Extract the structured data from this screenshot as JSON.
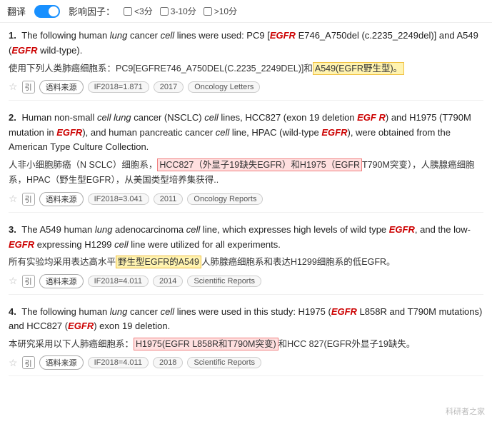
{
  "topbar": {
    "translate_label": "翻译",
    "influence_label": "影响因子：",
    "filters": [
      {
        "label": "<3分",
        "checked": false
      },
      {
        "label": "3-10分",
        "checked": false
      },
      {
        ">10分": ">10分",
        "label": ">10分",
        "checked": false
      }
    ]
  },
  "results": [
    {
      "number": "1.",
      "en_parts": [
        {
          "text": "The following human ",
          "style": "normal"
        },
        {
          "text": "lung",
          "style": "italic"
        },
        {
          "text": " cancer ",
          "style": "normal"
        },
        {
          "text": "cell",
          "style": "italic"
        },
        {
          "text": " lines were used: PC9 [",
          "style": "normal"
        },
        {
          "text": "EGFR",
          "style": "italic-red"
        },
        {
          "text": " E746_A750del (c.2235_2249del)] and A549 (",
          "style": "normal"
        },
        {
          "text": "EGFR",
          "style": "italic-red"
        },
        {
          "text": " wild-type).",
          "style": "normal"
        }
      ],
      "cn_parts": [
        {
          "text": "使用下列人类肺癌细胞系：PC9[EGFRE746_A750DEL(C.2235_2249DEL)]和",
          "style": "normal"
        },
        {
          "text": "A549(EGFR野生型)。",
          "style": "highlight-yellow"
        }
      ],
      "meta": {
        "year": "2017",
        "if": "IF2018=1.871",
        "journal": "Oncology Letters"
      }
    },
    {
      "number": "2.",
      "en_parts": [
        {
          "text": "Human non-small ",
          "style": "normal"
        },
        {
          "text": "cell lung",
          "style": "italic"
        },
        {
          "text": " cancer (NSCLC) ",
          "style": "normal"
        },
        {
          "text": "cell",
          "style": "italic"
        },
        {
          "text": " lines, HCC827 (exon 19 deletion ",
          "style": "normal"
        },
        {
          "text": "EGF R",
          "style": "italic-red"
        },
        {
          "text": ") and H1975 (T790M mutation in ",
          "style": "normal"
        },
        {
          "text": "EGFR",
          "style": "italic-red"
        },
        {
          "text": "), and human pancreatic cancer ",
          "style": "normal"
        },
        {
          "text": "cell",
          "style": "italic"
        },
        {
          "text": " line, HPAC (wild-type ",
          "style": "normal"
        },
        {
          "text": "EGFR",
          "style": "italic-red"
        },
        {
          "text": "), were obtained from the American Type Culture Collection.",
          "style": "normal"
        }
      ],
      "cn_parts": [
        {
          "text": "人非小细胞肺癌（N SCLC）细胞系，",
          "style": "normal"
        },
        {
          "text": "HCC827（外显子19缺失EGFR）和H1975（EGFR",
          "style": "highlight-red"
        },
        {
          "text": "T790M突变），人胰腺癌细胞系，HPAC（野生型EGFR），从美国类型培养集获得..",
          "style": "normal"
        }
      ],
      "meta": {
        "year": "2011",
        "if": "IF2018=3.041",
        "journal": "Oncology Reports"
      }
    },
    {
      "number": "3.",
      "en_parts": [
        {
          "text": "The A549 human ",
          "style": "normal"
        },
        {
          "text": "lung",
          "style": "italic"
        },
        {
          "text": " adenocarcinoma ",
          "style": "normal"
        },
        {
          "text": "cell",
          "style": "italic"
        },
        {
          "text": " line, which expresses high levels of wild type ",
          "style": "normal"
        },
        {
          "text": "EGFR",
          "style": "italic-red"
        },
        {
          "text": ", and the low-",
          "style": "normal"
        },
        {
          "text": "EGFR",
          "style": "italic-red"
        },
        {
          "text": " expressing H1299 ",
          "style": "normal"
        },
        {
          "text": "cell",
          "style": "italic"
        },
        {
          "text": " line were utilized for all experiments.",
          "style": "normal"
        }
      ],
      "cn_parts": [
        {
          "text": "所有实验均采用表达高水平",
          "style": "normal"
        },
        {
          "text": "野生型EGFR的A549",
          "style": "highlight-yellow"
        },
        {
          "text": "人肺腺癌细胞系和表达H1299细胞系的低EGFR。",
          "style": "normal"
        }
      ],
      "meta": {
        "year": "2014",
        "if": "IF2018=4.011",
        "journal": "Scientific Reports"
      }
    },
    {
      "number": "4.",
      "en_parts": [
        {
          "text": "The following human ",
          "style": "normal"
        },
        {
          "text": "lung",
          "style": "italic"
        },
        {
          "text": " cancer ",
          "style": "normal"
        },
        {
          "text": "cell",
          "style": "italic"
        },
        {
          "text": " lines were used in this study: H1975 (",
          "style": "normal"
        },
        {
          "text": "EGFR",
          "style": "italic-red"
        },
        {
          "text": " L858R and T790M mutations) and HCC827 (",
          "style": "normal"
        },
        {
          "text": "EGFR",
          "style": "italic-red"
        },
        {
          "text": ") exon 19 deletion.",
          "style": "normal"
        }
      ],
      "cn_parts": [
        {
          "text": "本研究采用以下人肺癌细胞系：",
          "style": "normal"
        },
        {
          "text": "H1975(EGFR L858R和T790M突变)",
          "style": "highlight-red"
        },
        {
          "text": "和HCC 827(EGFR外显子19缺失。",
          "style": "normal"
        }
      ],
      "meta": {
        "year": "2018",
        "if": "IF2018=4.011",
        "journal": "Scientific Reports"
      }
    }
  ],
  "watermark": "科研者之家"
}
